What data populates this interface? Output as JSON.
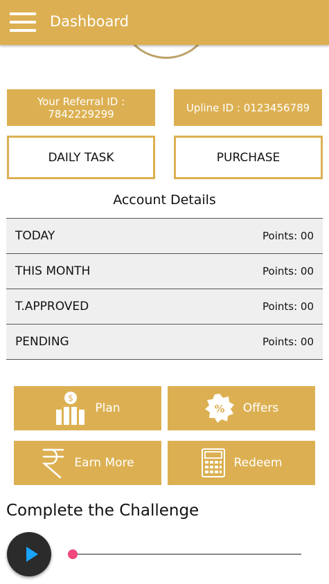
{
  "appbar": {
    "title": "Dashboard",
    "menu_icon": "hamburger-menu-icon"
  },
  "referral": {
    "label": "Your Referral ID :",
    "value": "7842229299"
  },
  "upline": {
    "text": "Upline ID : 0123456789"
  },
  "actions": {
    "daily_task": "DAILY TASK",
    "purchase": "PURCHASE"
  },
  "account": {
    "title": "Account Details",
    "rows": [
      {
        "label": "TODAY",
        "value": "Points: 00"
      },
      {
        "label": "THIS MONTH",
        "value": "Points: 00"
      },
      {
        "label": "T.APPROVED",
        "value": "Points: 00"
      },
      {
        "label": "PENDING",
        "value": "Points: 00"
      }
    ]
  },
  "tiles": [
    {
      "label": "Plan",
      "icon": "money-chart-icon"
    },
    {
      "label": "Offers",
      "icon": "percent-badge-icon"
    },
    {
      "label": "Earn More",
      "icon": "rupee-icon"
    },
    {
      "label": "Redeem",
      "icon": "calculator-icon"
    }
  ],
  "challenge": {
    "title": "Complete the Challenge",
    "progress": 0
  },
  "colors": {
    "accent": "#dcb052",
    "row_bg": "#efefef",
    "play": "#1aa3ff",
    "slider_thumb": "#f2487e"
  }
}
